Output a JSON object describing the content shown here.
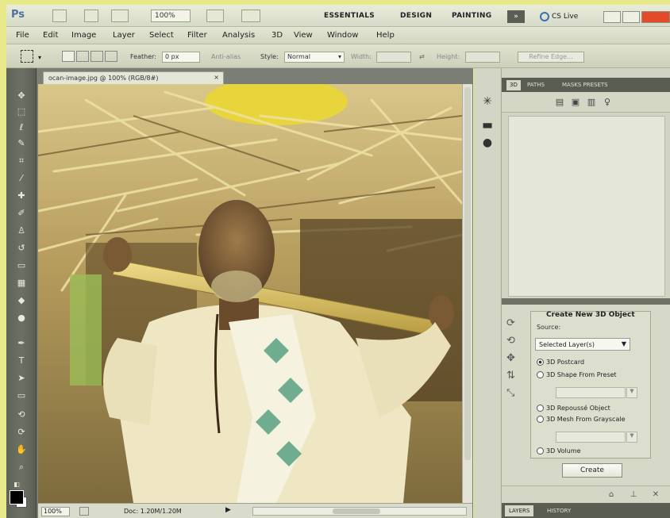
{
  "appbar": {
    "logo": "Ps",
    "zoom": "100%",
    "workspaces": [
      "ESSENTIALS",
      "DESIGN",
      "PAINTING"
    ],
    "more_label": "»",
    "cslive_label": "CS Live"
  },
  "menu": [
    "File",
    "Edit",
    "Image",
    "Layer",
    "Select",
    "Filter",
    "Analysis",
    "3D",
    "View",
    "Window",
    "Help"
  ],
  "options": {
    "feather_label": "Feather:",
    "feather_value": "0 px",
    "antialias_label": "Anti-alias",
    "style_label": "Style:",
    "style_value": "Normal",
    "width_label": "Width:",
    "height_label": "Height:",
    "refine_label": "Refine Edge..."
  },
  "document": {
    "tab_title": "ocan-image.jpg @ 100% (RGB/8#)",
    "status_zoom": "100%",
    "status_doc": "Doc: 1.20M/1.20M"
  },
  "right_panel": {
    "tabs": [
      "3D",
      "PATHS",
      "MASKS PRESETS"
    ],
    "create_title": "Create New 3D Object",
    "source_label": "Source:",
    "source_value": "Selected Layer(s)",
    "options": [
      {
        "label": "3D Postcard",
        "selected": true
      },
      {
        "label": "3D Shape From Preset",
        "selected": false
      },
      {
        "label": "3D Repoussé Object",
        "selected": false
      },
      {
        "label": "3D Mesh From Grayscale",
        "selected": false
      },
      {
        "label": "3D Volume",
        "selected": false
      }
    ],
    "create_button": "Create",
    "bottom_tabs": [
      "LAYERS",
      "HISTORY"
    ]
  },
  "colors": {
    "foreground": "#000000",
    "background": "#ffffff"
  }
}
